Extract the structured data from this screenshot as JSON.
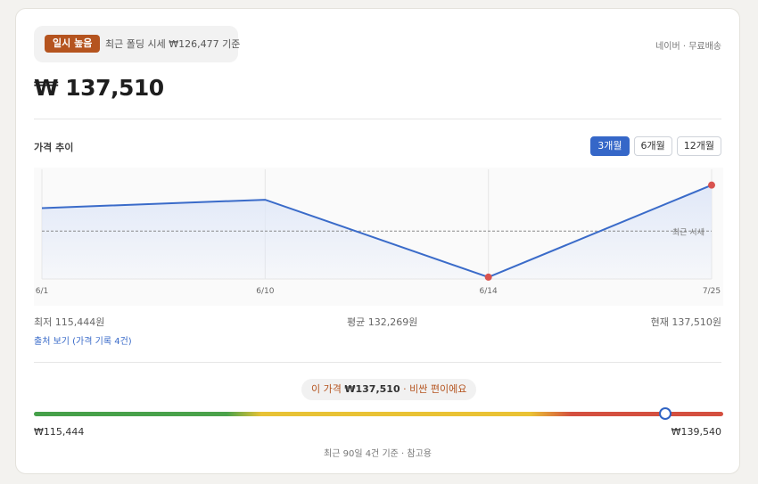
{
  "header": {
    "badge": "일시 높음",
    "recent_deal": "최근 폴딩 시세 ₩126,477 기준",
    "seller": "네이버 · 무료배송"
  },
  "price": "₩ 137,510",
  "trend": {
    "title": "가격 추이",
    "periods": [
      {
        "label": "3개월",
        "active": true
      },
      {
        "label": "6개월",
        "active": false
      },
      {
        "label": "12개월",
        "active": false
      }
    ]
  },
  "chart_data": {
    "type": "line",
    "x": [
      "6/1",
      "6/10",
      "6/14",
      "7/25"
    ],
    "values": [
      132000,
      134000,
      115444,
      137510
    ],
    "ylim": [
      115000,
      140000
    ],
    "reference_line": {
      "value": 126477,
      "label": "최근 시세"
    },
    "colors": {
      "line": "#3a6bc9",
      "fill": "#dfe7f8",
      "marker": "#d9534f"
    },
    "grid": true
  },
  "stats": {
    "min": "최저 115,444원",
    "avg": "평균 132,269원",
    "current": "현재 137,510원"
  },
  "source_link": "출처 보기 (가격 기록 4건)",
  "verdict": {
    "prefix": "이 가격 ",
    "price": "₩137,510",
    "suffix": " · 비싼 편이에요"
  },
  "gauge": {
    "min_label": "₩115,444",
    "max_label": "₩139,540",
    "min": 115444,
    "max": 139540,
    "value": 137510
  },
  "footnote": "최근 90일 4건 기준 · 참고용"
}
